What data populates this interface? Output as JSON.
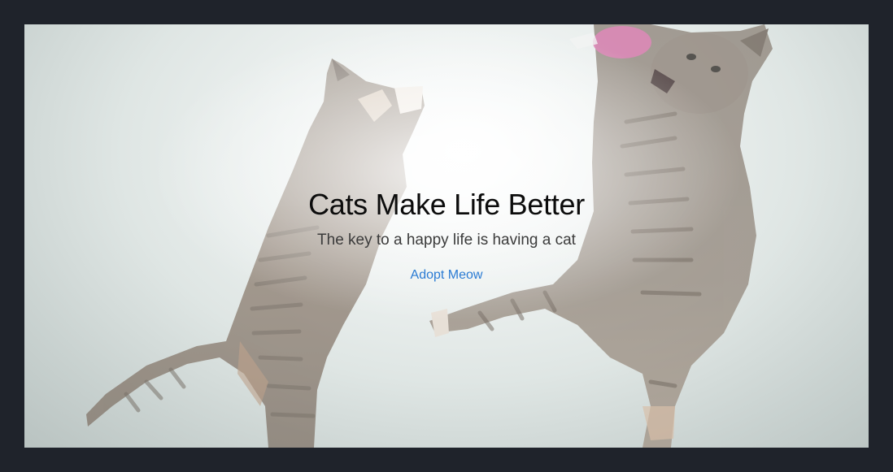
{
  "hero": {
    "title": "Cats Make Life Better",
    "subtitle": "The key to a happy life is having a cat",
    "cta_label": "Adopt Meow",
    "image_alt": "two tabby cats jumping",
    "colors": {
      "page_background": "#1f232b",
      "link": "#2a7bd3",
      "title": "#0c0c0c",
      "subtitle": "#3b3b3b"
    }
  }
}
